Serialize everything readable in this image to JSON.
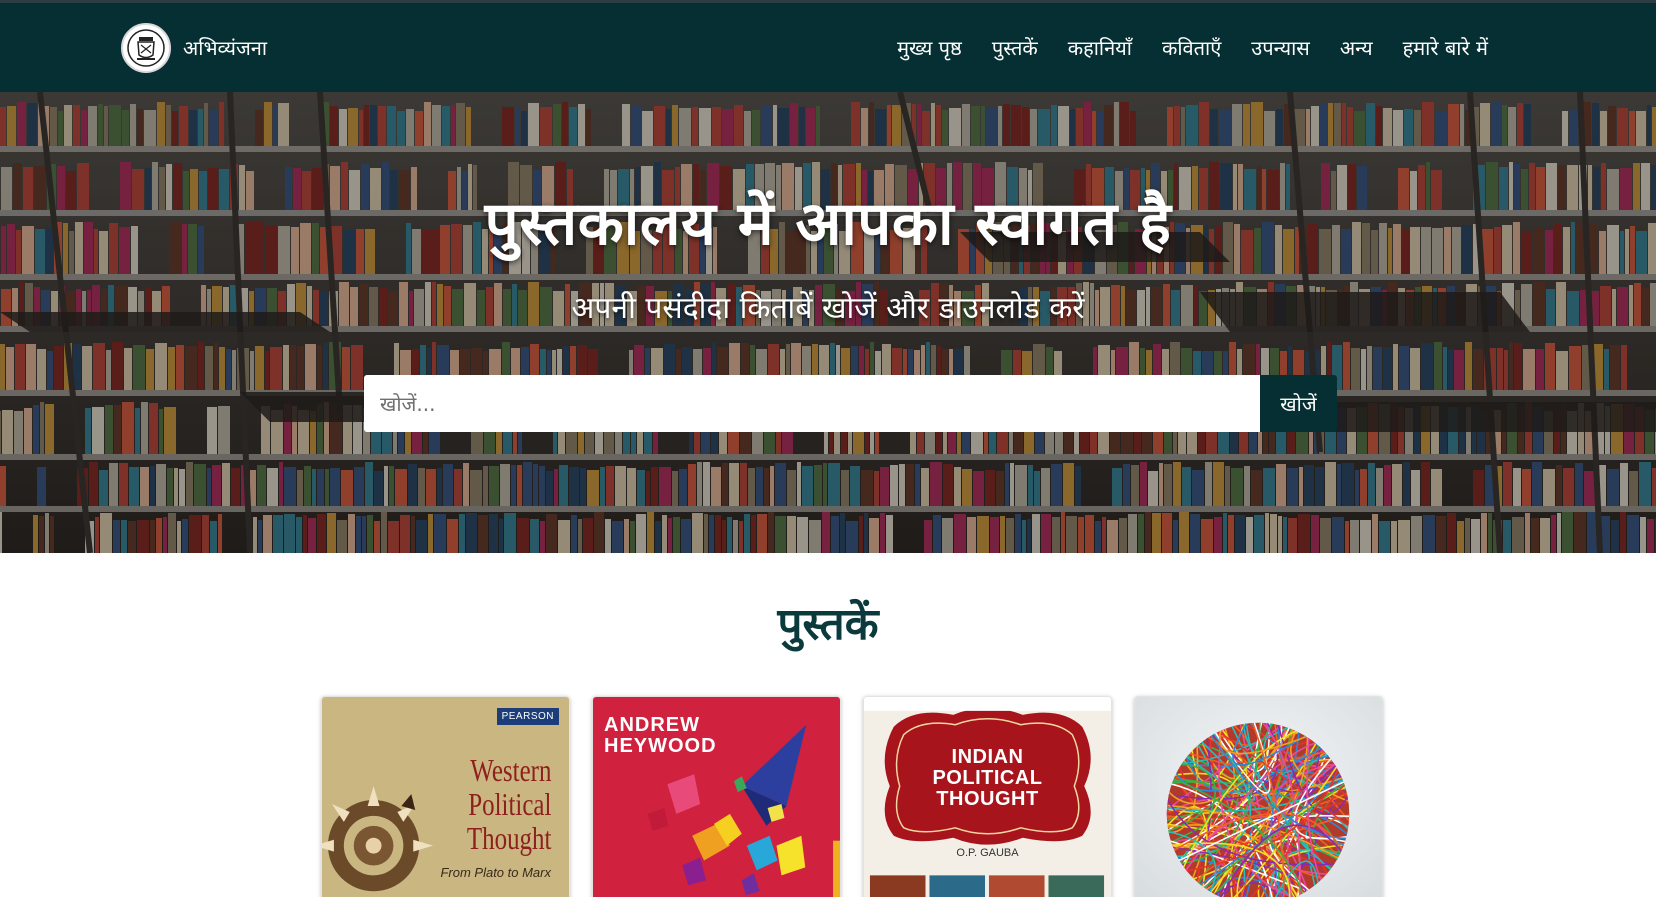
{
  "brand": {
    "name": "अभिव्यंजना",
    "logo_icon": "university-seal-icon"
  },
  "nav": {
    "items": [
      {
        "label": "मुख्य पृष्ठ"
      },
      {
        "label": "पुस्तकें"
      },
      {
        "label": "कहानियाँ"
      },
      {
        "label": "कविताएँ"
      },
      {
        "label": "उपन्यास"
      },
      {
        "label": "अन्य"
      },
      {
        "label": "हमारे बारे में"
      }
    ]
  },
  "hero": {
    "title": "पुस्तकालय में आपका स्वागत है",
    "subtitle": "अपनी पसंदीदा किताबें खोजें और डाउनलोड करें",
    "background": "library-bookshelves-photo"
  },
  "search": {
    "placeholder": "खोजें...",
    "value": "",
    "button_label": "खोजें"
  },
  "books_section": {
    "heading": "पुस्तकें",
    "books": [
      {
        "publisher": "PEARSON",
        "title": "Western Political Thought",
        "title_lines": [
          "Western",
          "Political",
          "Thought"
        ],
        "subtitle": "From Plato to Marx"
      },
      {
        "author_lines": [
          "ANDREW",
          "HEYWOOD"
        ]
      },
      {
        "title_lines": [
          "INDIAN",
          "POLITICAL",
          "THOUGHT"
        ],
        "author": "O.P. GAUBA"
      },
      {
        "cover_image": "colorful-string-ball-image"
      }
    ]
  },
  "colors": {
    "navbar_bg": "#062f33",
    "accent": "#062f33",
    "heading": "#0b3a3d"
  }
}
